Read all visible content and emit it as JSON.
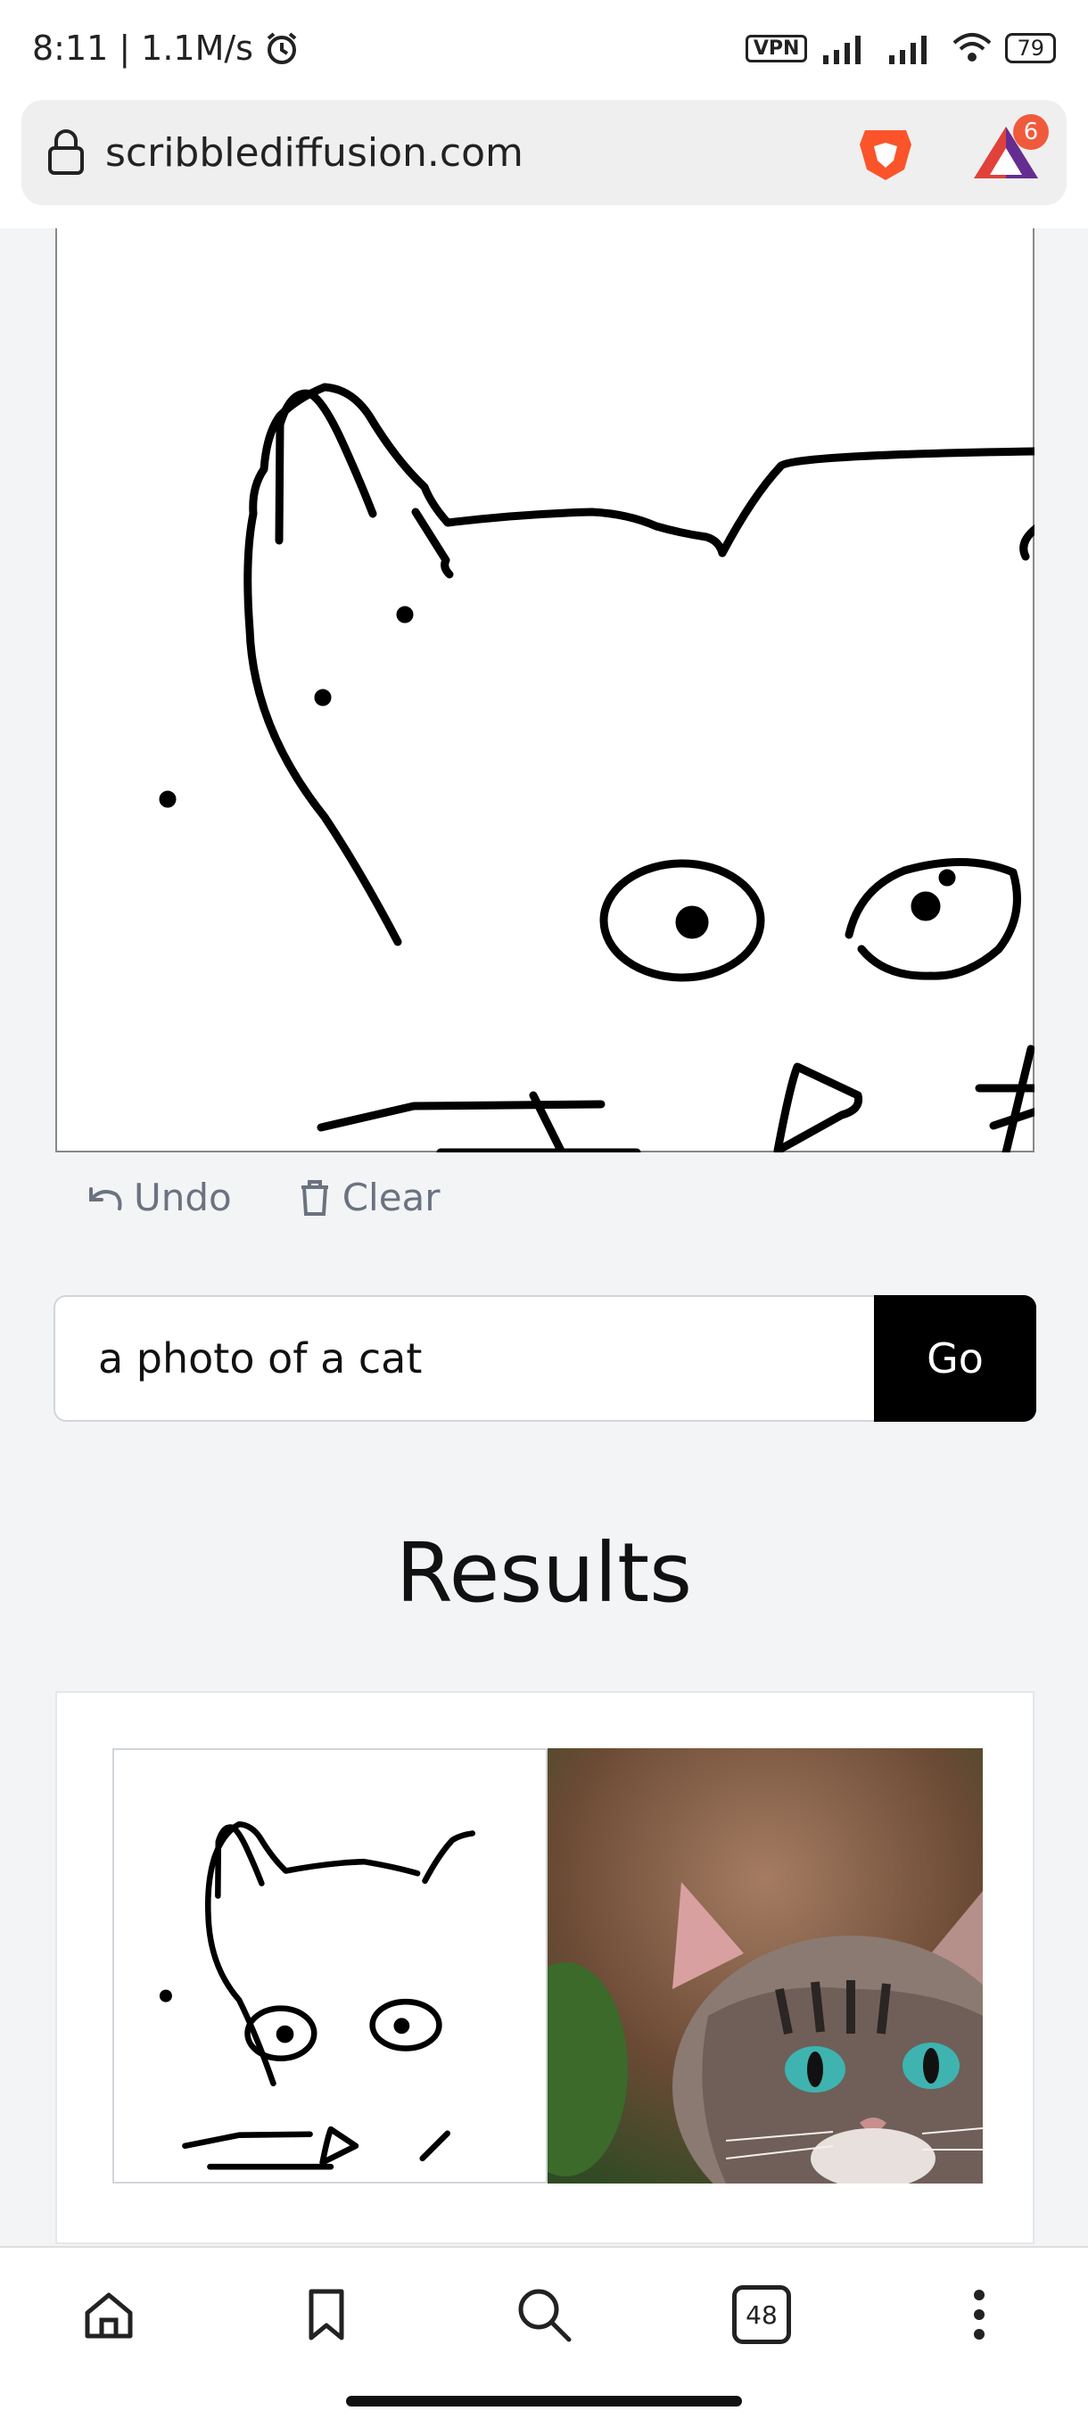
{
  "status_bar": {
    "time": "8:11",
    "net_speed": "1.1M/s",
    "vpn": "VPN",
    "battery": "79"
  },
  "browser": {
    "url": "scribblediffusion.com",
    "rewards_badge": "6",
    "tab_count": "48"
  },
  "tools": {
    "undo_label": "Undo",
    "clear_label": "Clear"
  },
  "prompt": {
    "value": "a photo of a cat",
    "go_label": "Go"
  },
  "results": {
    "title": "Results"
  },
  "colors": {
    "page_bg": "#f3f4f6",
    "button_bg": "#000000",
    "muted_text": "#6b7280",
    "brave_orange": "#fb542b"
  },
  "icons": [
    "lock-icon",
    "brave-lion-icon",
    "brave-rewards-icon",
    "undo-icon",
    "trash-icon",
    "home-icon",
    "bookmark-icon",
    "search-icon",
    "more-vertical-icon"
  ]
}
